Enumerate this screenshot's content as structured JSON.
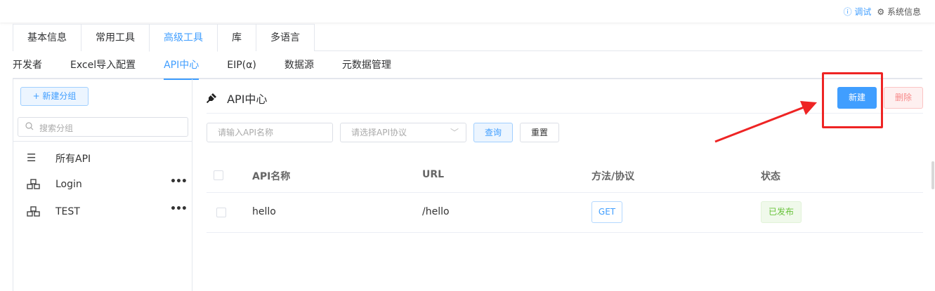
{
  "topbar": {
    "debug_label": "ⓘ 调试",
    "sysinfo_label": "⚙ 系统信息"
  },
  "tabs_primary": [
    "基本信息",
    "常用工具",
    "高级工具",
    "库",
    "多语言"
  ],
  "tabs_secondary": [
    "开发者",
    "Excel导入配置",
    "API中心",
    "EIP(α)",
    "数据源",
    "元数据管理"
  ],
  "sidebar": {
    "new_group_label": "+ 新建分组",
    "search_placeholder": "搜索分组",
    "items": [
      {
        "icon": "list-icon",
        "label": "所有API"
      },
      {
        "icon": "cubes-icon",
        "label": "Login",
        "more": "•••"
      },
      {
        "icon": "cubes-icon",
        "label": "TEST",
        "more": "•••"
      }
    ]
  },
  "main": {
    "title": "API中心",
    "create_label": "新建",
    "delete_label": "删除",
    "name_placeholder": "请输入API名称",
    "protocol_placeholder": "请选择API协议",
    "query_label": "查询",
    "reset_label": "重置",
    "columns": [
      "API名称",
      "URL",
      "方法/协议",
      "状态"
    ],
    "rows": [
      {
        "name": "hello",
        "url": "/hello",
        "method": "GET",
        "status": "已发布"
      }
    ]
  },
  "colors": {
    "primary": "#409eff",
    "annotation": "#ee2424",
    "success": "#67c23a",
    "danger": "#f78989"
  }
}
